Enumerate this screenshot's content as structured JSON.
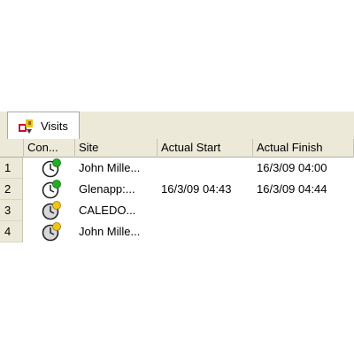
{
  "tabs": [
    {
      "label": "Visits",
      "icon": "visits-tab-icon"
    }
  ],
  "table": {
    "columns": [
      "Con...",
      "Site",
      "Actual Start",
      "Actual Finish"
    ],
    "rows": [
      {
        "num": "1",
        "status_icon": "clock-green-icon",
        "status_color": "#22b022",
        "site": "John Mille...",
        "actual_start": "",
        "actual_finish": "16/3/09 04:00"
      },
      {
        "num": "2",
        "status_icon": "clock-green-icon",
        "status_color": "#22b022",
        "site": "Glenapp:...",
        "actual_start": "16/3/09 04:43",
        "actual_finish": "16/3/09 04:44"
      },
      {
        "num": "3",
        "status_icon": "clock-yellow-icon",
        "status_color": "#f2c418",
        "site": "CALEDO...",
        "actual_start": "",
        "actual_finish": ""
      },
      {
        "num": "4",
        "status_icon": "clock-yellow-icon",
        "status_color": "#f2c418",
        "site": "John Mille...",
        "actual_start": "",
        "actual_finish": ""
      }
    ]
  }
}
